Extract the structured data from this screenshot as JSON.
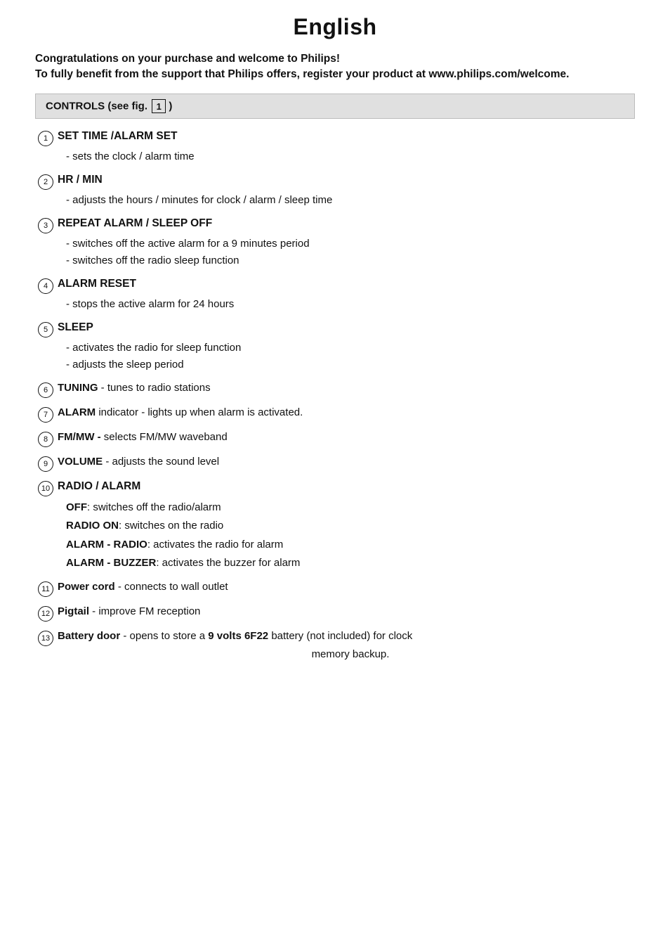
{
  "title": "English",
  "welcome": {
    "line1": "Congratulations on your purchase and welcome to Philips!",
    "line2": "To fully benefit from the support that Philips offers, register your product at www.philips.com/welcome."
  },
  "controls_header": "CONTROLS (see fig.",
  "controls_fig": "1",
  "controls_header_suffix": ")",
  "items": [
    {
      "num": "1",
      "label": "SET TIME /ALARM SET",
      "descs": [
        "- sets the clock / alarm time"
      ],
      "inline": false
    },
    {
      "num": "2",
      "label": "HR / MIN",
      "descs": [
        "- adjusts the hours / minutes for clock / alarm / sleep time"
      ],
      "inline": false
    },
    {
      "num": "3",
      "label": "REPEAT ALARM / SLEEP OFF",
      "descs": [
        "- switches off the active alarm for a 9 minutes period",
        "- switches off the radio sleep function"
      ],
      "inline": false
    },
    {
      "num": "4",
      "label": "ALARM RESET",
      "descs": [
        "- stops the active alarm for 24 hours"
      ],
      "inline": false
    },
    {
      "num": "5",
      "label": "SLEEP",
      "descs": [
        "- activates the radio for sleep function",
        "- adjusts the sleep period"
      ],
      "inline": false
    },
    {
      "num": "6",
      "label": "TUNING",
      "inline_text": " - tunes to radio stations",
      "inline": true
    },
    {
      "num": "7",
      "label": "ALARM",
      "inline_text": " indicator - lights up when alarm is activated.",
      "inline": true
    },
    {
      "num": "8",
      "label": "FM/MW -",
      "inline_text": " selects FM/MW waveband",
      "inline": true
    },
    {
      "num": "9",
      "label": "VOLUME",
      "inline_text": " - adjusts the sound level",
      "inline": true
    },
    {
      "num": "10",
      "label": "RADIO / ALARM",
      "inline": false,
      "descs": [],
      "sub_items": [
        {
          "sub_label": "OFF",
          "sub_text": ": switches off the radio/alarm"
        },
        {
          "sub_label": "RADIO ON",
          "sub_text": ": switches on the radio"
        },
        {
          "sub_label": "ALARM - RADIO",
          "sub_text": ": activates the radio for alarm"
        },
        {
          "sub_label": "ALARM - BUZZER",
          "sub_text": ": activates the buzzer for alarm"
        }
      ]
    },
    {
      "num": "11",
      "label": "Power cord",
      "inline_text": " - connects to wall outlet",
      "inline": true
    },
    {
      "num": "12",
      "label": "Pigtail",
      "inline_text": " - improve FM reception",
      "inline": true
    },
    {
      "num": "13",
      "label": "Battery door",
      "inline_text_prefix": " - opens to store a ",
      "inline_bold": "9 volts 6F22",
      "inline_text_suffix": " battery (not included) for clock",
      "inline_second_line": "memory backup.",
      "inline": "complex"
    }
  ]
}
